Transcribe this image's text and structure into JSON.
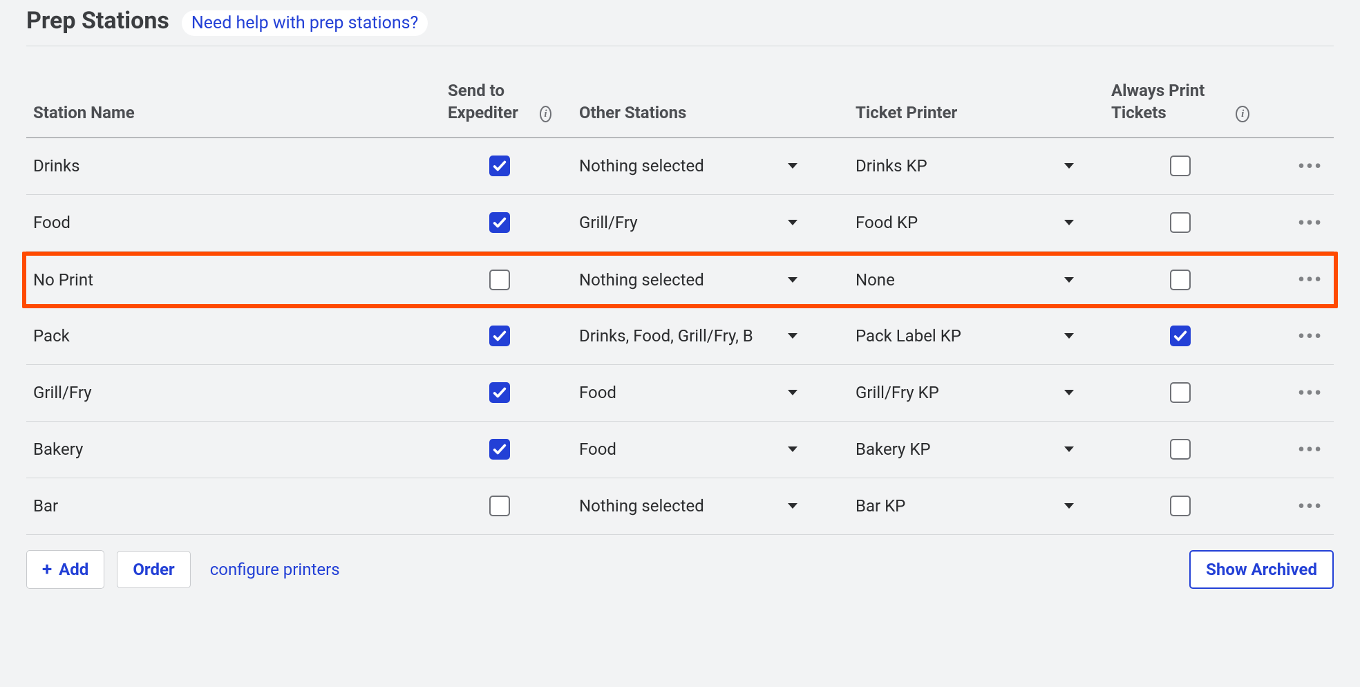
{
  "header": {
    "title": "Prep Stations",
    "help_link": "Need help with prep stations?"
  },
  "columns": {
    "name": "Station Name",
    "expediter": "Send to Expediter",
    "other": "Other Stations",
    "printer": "Ticket Printer",
    "always": "Always Print Tickets"
  },
  "rows": [
    {
      "name": "Drinks",
      "expediter": true,
      "other": "Nothing selected",
      "printer": "Drinks KP",
      "always": false,
      "highlight": false
    },
    {
      "name": "Food",
      "expediter": true,
      "other": "Grill/Fry",
      "printer": "Food KP",
      "always": false,
      "highlight": false
    },
    {
      "name": "No Print",
      "expediter": false,
      "other": "Nothing selected",
      "printer": "None",
      "always": false,
      "highlight": true
    },
    {
      "name": "Pack",
      "expediter": true,
      "other": "Drinks, Food, Grill/Fry, B",
      "printer": "Pack Label KP",
      "always": true,
      "highlight": false
    },
    {
      "name": "Grill/Fry",
      "expediter": true,
      "other": "Food",
      "printer": "Grill/Fry KP",
      "always": false,
      "highlight": false
    },
    {
      "name": "Bakery",
      "expediter": true,
      "other": "Food",
      "printer": "Bakery KP",
      "always": false,
      "highlight": false
    },
    {
      "name": "Bar",
      "expediter": false,
      "other": "Nothing selected",
      "printer": "Bar KP",
      "always": false,
      "highlight": false
    }
  ],
  "footer": {
    "add": "Add",
    "order": "Order",
    "configure": "configure printers",
    "archived": "Show Archived"
  }
}
